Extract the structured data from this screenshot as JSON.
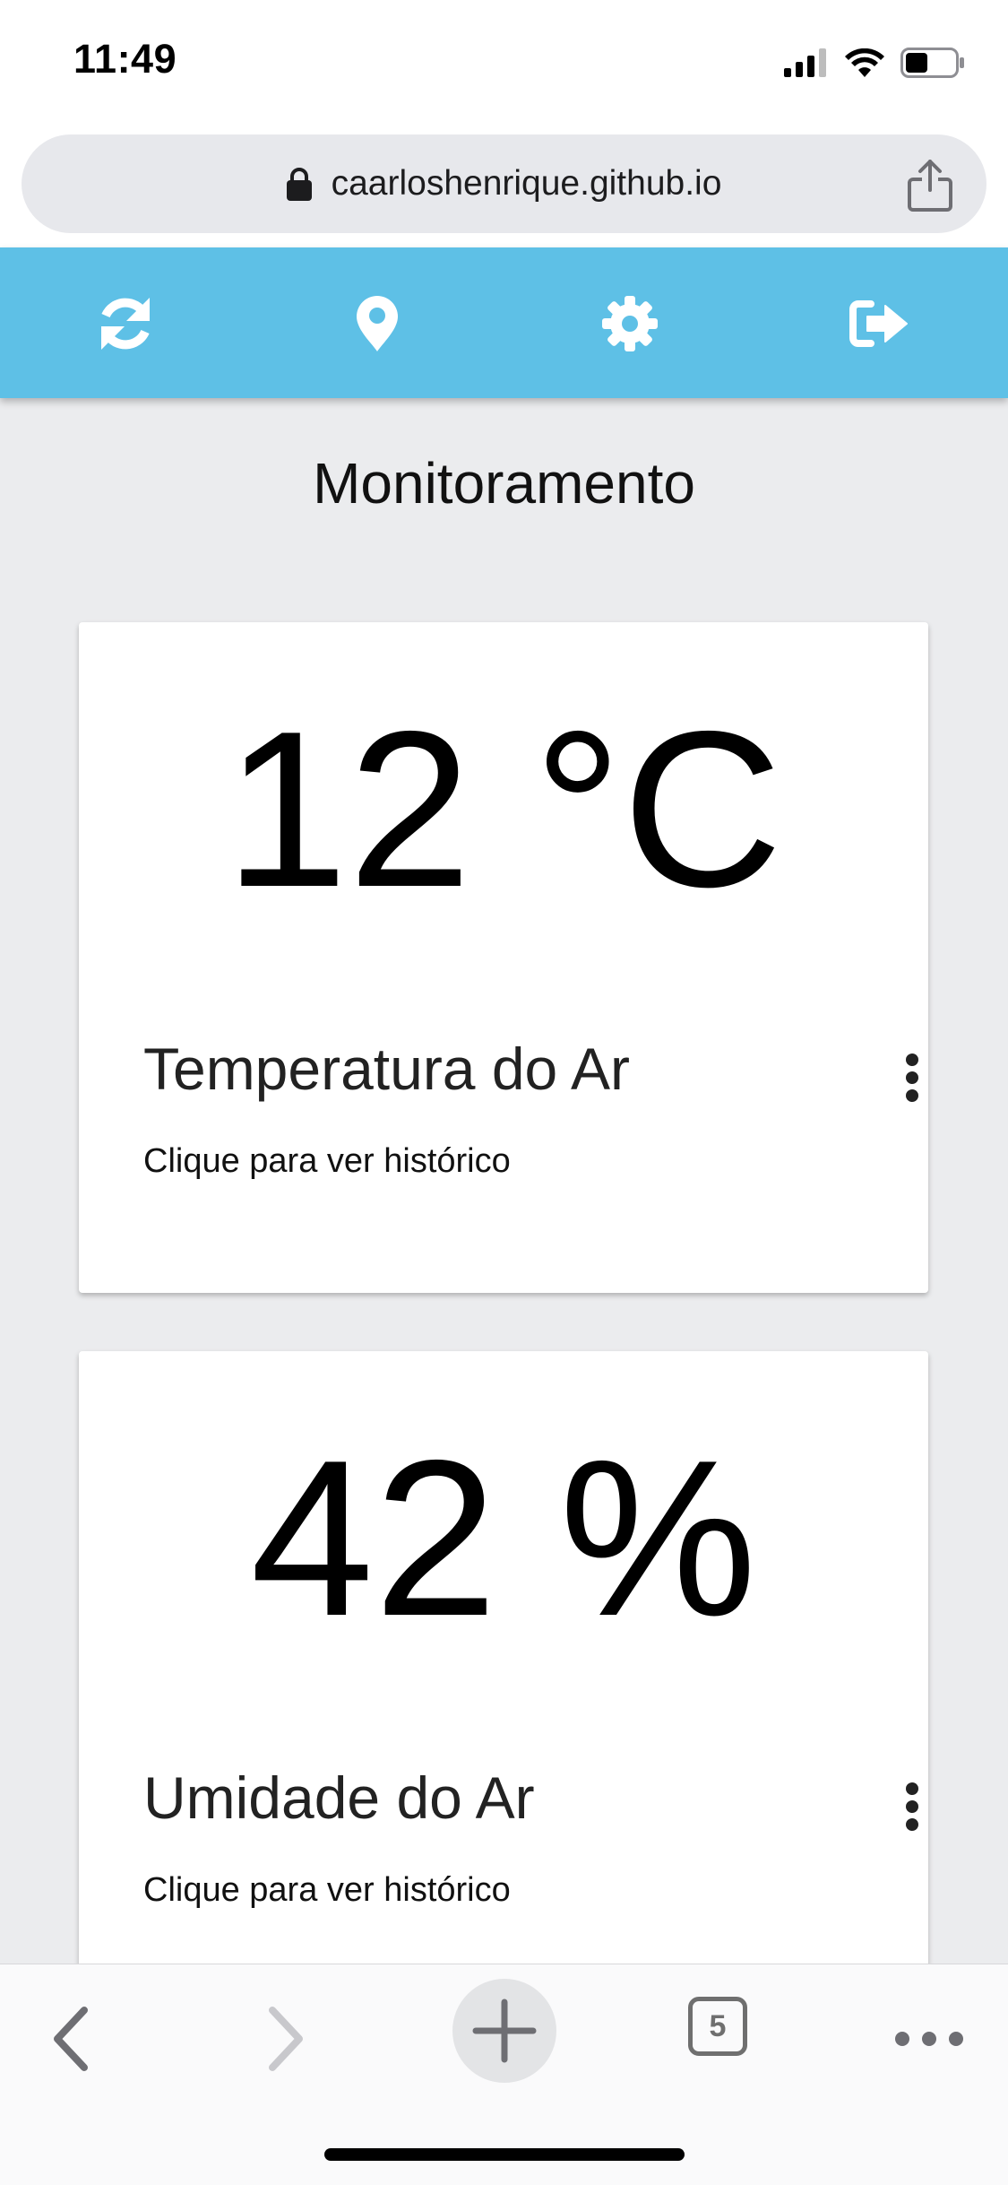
{
  "status_bar": {
    "time": "11:49",
    "icons": [
      "cellular-signal-icon",
      "wifi-icon",
      "battery-icon"
    ]
  },
  "url_bar": {
    "url": "caarloshenrique.github.io",
    "lock_icon": "lock-icon",
    "share_icon": "share-icon"
  },
  "toolbar": {
    "background_color": "#5EC0E6",
    "buttons": [
      {
        "icon": "refresh-icon"
      },
      {
        "icon": "location-pin-icon"
      },
      {
        "icon": "gear-icon"
      },
      {
        "icon": "logout-icon"
      }
    ]
  },
  "page": {
    "title": "Monitoramento"
  },
  "cards": [
    {
      "value": "12 °C",
      "label": "Temperatura do Ar",
      "subtitle": "Clique para ver histórico",
      "menu_icon": "more-vertical-icon"
    },
    {
      "value": "42 %",
      "label": "Umidade do Ar",
      "subtitle": "Clique para ver histórico",
      "menu_icon": "more-vertical-icon"
    }
  ],
  "bottom_bar": {
    "back_icon": "back-chevron-icon",
    "forward_icon": "forward-chevron-icon",
    "new_tab_icon": "plus-icon",
    "tab_count": "5",
    "more_icon": "more-horizontal-icon"
  }
}
